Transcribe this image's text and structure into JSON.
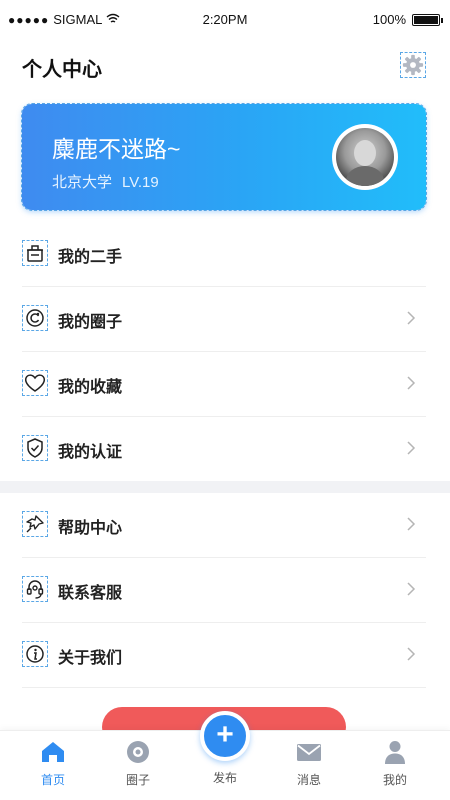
{
  "status_bar": {
    "carrier": "SIGMAL",
    "time": "2:20PM",
    "battery": "100%"
  },
  "header": {
    "title": "个人中心",
    "settings_icon": "gear-icon"
  },
  "profile": {
    "nickname": "麋鹿不迷路~",
    "school": "北京大学",
    "level": "LV.19"
  },
  "menu": {
    "items": [
      {
        "label": "我的二手",
        "icon": "trash-box-icon",
        "chevron": false
      },
      {
        "label": "我的圈子",
        "icon": "circle-refresh-icon",
        "chevron": true
      },
      {
        "label": "我的收藏",
        "icon": "heart-icon",
        "chevron": true
      },
      {
        "label": "我的认证",
        "icon": "shield-check-icon",
        "chevron": true
      },
      {
        "label": "帮助中心",
        "icon": "help-pin-icon",
        "chevron": true
      },
      {
        "label": "联系客服",
        "icon": "headset-icon",
        "chevron": true
      },
      {
        "label": "关于我们",
        "icon": "info-icon",
        "chevron": true
      }
    ]
  },
  "tab_bar": {
    "tabs": [
      {
        "label": "首页",
        "icon": "home-icon",
        "active": true
      },
      {
        "label": "圈子",
        "icon": "circle-icon",
        "active": false
      },
      {
        "label": "发布",
        "icon": "plus-icon",
        "active": false
      },
      {
        "label": "消息",
        "icon": "mail-icon",
        "active": false
      },
      {
        "label": "我的",
        "icon": "user-icon",
        "active": false
      }
    ]
  },
  "colors": {
    "accent": "#2f8cf1",
    "card_gradient_start": "#3f8bf0",
    "card_gradient_end": "#21bdfa",
    "danger": "#f05a5a"
  }
}
